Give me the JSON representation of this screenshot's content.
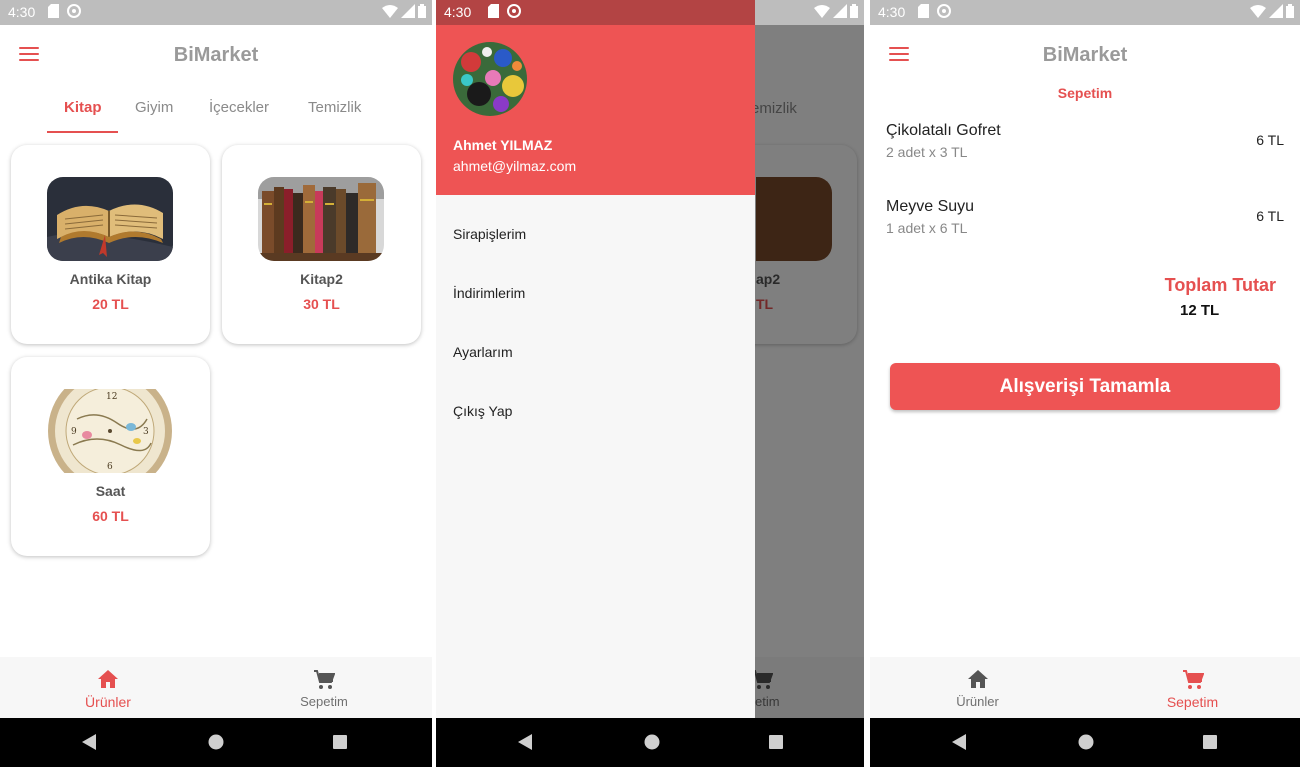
{
  "status_bar": {
    "time": "4:30"
  },
  "app": {
    "title": "BiMarket"
  },
  "products_screen": {
    "categories": [
      {
        "label": "Kitap",
        "active": true
      },
      {
        "label": "Giyim",
        "active": false
      },
      {
        "label": "İçecekler",
        "active": false
      },
      {
        "label": "Temizlik",
        "active": false
      }
    ],
    "products": [
      {
        "name": "Antika Kitap",
        "price": "20 TL",
        "image_icon": "old-book-image"
      },
      {
        "name": "Kitap2",
        "price": "30 TL",
        "image_icon": "bookshelf-image"
      },
      {
        "name": "Saat",
        "price": "60 TL",
        "image_icon": "clock-image"
      }
    ]
  },
  "bottom_tabs": [
    {
      "label": "Ürünler",
      "icon": "home-icon"
    },
    {
      "label": "Sepetim",
      "icon": "cart-icon"
    }
  ],
  "drawer": {
    "user_name": "Ahmet YILMAZ",
    "user_email": "ahmet@yilmaz.com",
    "menu": [
      "Sirapişlerim",
      "İndirimlerim",
      "Ayarlarım",
      "Çıkış Yap"
    ],
    "behind": {
      "tab_partial": "emizlik",
      "card_name_partial": "ap2",
      "card_price_partial": "TL",
      "bottom_label_partial": "etim"
    }
  },
  "cart_screen": {
    "title": "Sepetim",
    "items": [
      {
        "name": "Çikolatalı Gofret",
        "detail": "2 adet x 3 TL",
        "total": "6 TL"
      },
      {
        "name": "Meyve Suyu",
        "detail": "1 adet x 6 TL",
        "total": "6 TL"
      }
    ],
    "total_label": "Toplam Tutar",
    "total_value": "12 TL",
    "checkout_label": "Alışverişi Tamamla"
  },
  "colors": {
    "accent": "#e55050",
    "drawer_header": "#ee5454",
    "status_bar": "#bdbdbd"
  }
}
